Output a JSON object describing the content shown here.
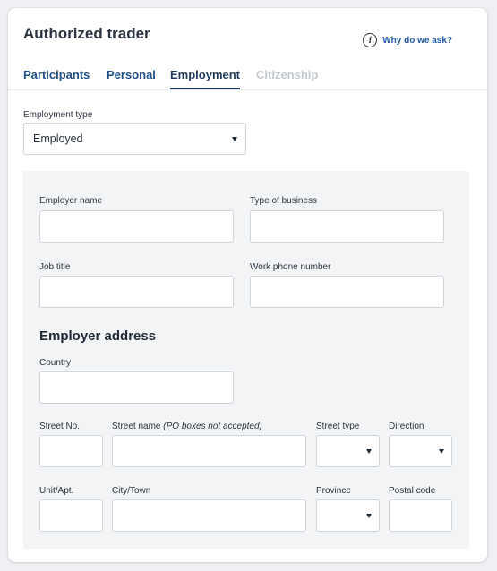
{
  "card": {
    "title": "Authorized trader",
    "why_link": "Why do we ask?",
    "info_icon_glyph": "i"
  },
  "tabs": [
    {
      "label": "Participants",
      "state": "normal"
    },
    {
      "label": "Personal",
      "state": "normal"
    },
    {
      "label": "Employment",
      "state": "active"
    },
    {
      "label": "Citizenship",
      "state": "disabled"
    }
  ],
  "employment_type": {
    "label": "Employment type",
    "value": "Employed"
  },
  "form": {
    "employer_name_label": "Employer name",
    "type_of_business_label": "Type of business",
    "job_title_label": "Job title",
    "work_phone_label": "Work phone number",
    "address_heading": "Employer address",
    "country_label": "Country",
    "street_no_label": "Street No.",
    "street_name_label": "Street name",
    "street_name_note": "(PO boxes not accepted)",
    "street_type_label": "Street type",
    "direction_label": "Direction",
    "unit_label": "Unit/Apt.",
    "city_label": "City/Town",
    "province_label": "Province",
    "postal_code_label": "Postal code"
  },
  "colors": {
    "link": "#1e5aa8",
    "tab_active": "#1f3a5c",
    "tab_disabled": "#c3c8cf",
    "panel_bg": "#f3f4f6"
  }
}
